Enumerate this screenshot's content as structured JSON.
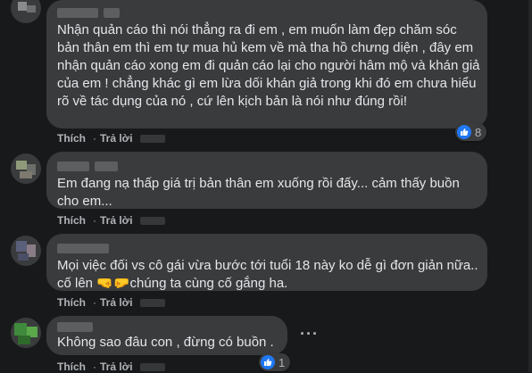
{
  "comments": [
    {
      "text": "Nhận quản cáo thì nói thẳng ra đi em , em muốn làm đẹp chăm sóc bản thân em thì em tự mua hủ kem về mà tha hồ chưng diện , đây em nhận quản cáo xong em đi quản cáo lại cho người hâm mộ và khán giả của em ! chẳng khác gì em lừa dối khán giả trong khi đó em chưa hiểu rõ về tác dụng của nó , cứ lên kịch bản là nói như đúng rồi!",
      "like_label": "Thích",
      "reply_label": "Trả lời",
      "reaction_count": "8"
    },
    {
      "text": "Em đang nạ thấp giá trị bản thân em xuống rồi đấy... cảm thấy buồn cho em...",
      "like_label": "Thích",
      "reply_label": "Trả lời"
    },
    {
      "text": "Mọi việc đối vs cô gái vừa bước tới tuổi 18 này ko dễ gì đơn giản nữa.. cố lên 🤜🤛chúng ta cùng cố gắng ha.",
      "like_label": "Thích",
      "reply_label": "Trả lời"
    },
    {
      "text": "Không sao đâu con , đừng có buồn .",
      "like_label": "Thích",
      "reply_label": "Trả lời",
      "reaction_count": "1"
    }
  ],
  "icons": {
    "like": "like-icon",
    "more": "more-options-icon"
  },
  "colors": {
    "background": "#18191a",
    "bubble": "#3a3b3c",
    "like_blue": "#2078f4"
  }
}
